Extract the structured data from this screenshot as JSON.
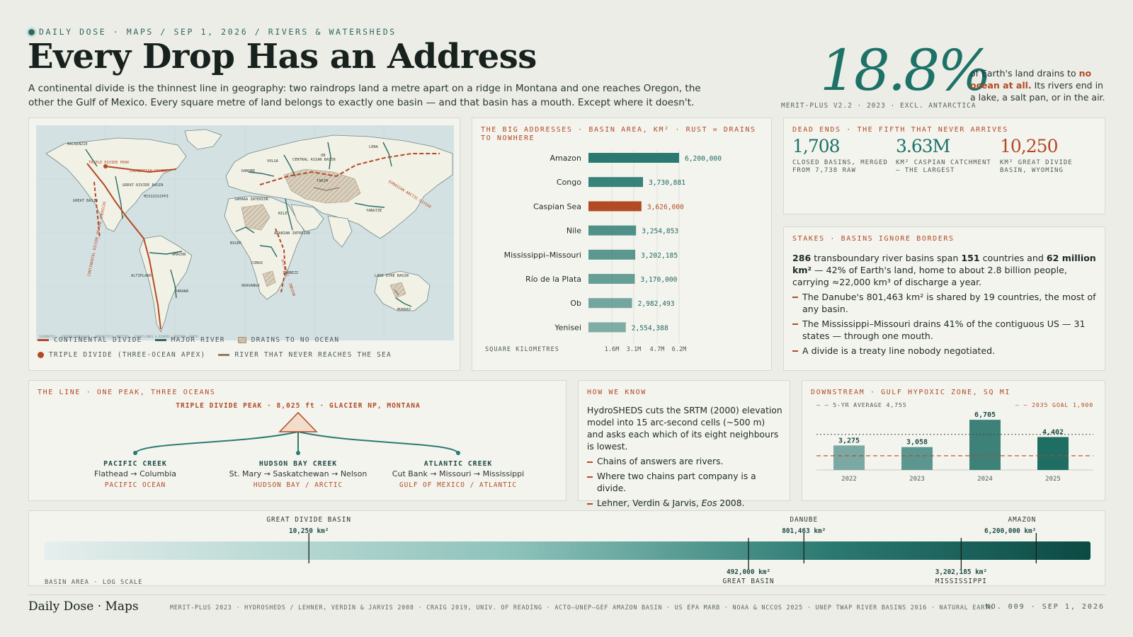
{
  "header": {
    "kicker": "DAILY DOSE · MAPS / SEP 1, 2026 / RIVERS & WATERSHEDS",
    "title": "Every Drop Has an Address",
    "lede": "A continental divide is the thinnest line in geography: two raindrops land a metre apart on a ridge in Montana and one reaches Oregon, the other the Gulf of Mexico. Every square metre of land belongs to exactly one basin — and that basin has a mouth. Except where it doesn't."
  },
  "hero": {
    "value": "18.8%",
    "note": "MERIT-PLUS V2.2 · 2023 · EXCL. ANTARCTICA",
    "text_pre": "of Earth's land drains to ",
    "text_highlight": "no ocean at all.",
    "text_post": " Its rivers end in a lake, a salt pan, or in the air."
  },
  "map": {
    "labels": {
      "mackenzie": "MACKENZIE",
      "triple_divide": "TRIPLE DIVIDE PEAK",
      "laurentian": "LAURENTIAN DIVIDE",
      "great_divide": "GREAT DIVIDE BASIN",
      "mississippi": "MISSISSIPPI",
      "great_basin": "GREAT BASIN",
      "continental": "CONTINENTAL DIVIDE OF THE AMERICAS",
      "amazon": "AMAZON",
      "altiplano": "ALTIPLANO",
      "parana": "PARANÁ",
      "volga": "VOLGA",
      "danube": "DANUBE",
      "central_asian": "CENTRAL ASIAN BASIN",
      "ob": "OB",
      "lena": "LENA",
      "eurasian": "EURASIAN ARCTIC DIVIDE",
      "tarim": "TARIM",
      "sahara": "SAHARA INTERIOR",
      "nile": "NILE",
      "yangtze": "YANGTZE",
      "arabian": "ARABIAN INTERIOR",
      "niger": "NIGER",
      "congo": "CONGO",
      "zambezi": "ZAMBEZI",
      "atlantic_indian": "ATLANTIC · INDIAN",
      "okavango": "OKAVANGO",
      "lake_eyre": "LAKE EYRE BASIN",
      "murray": "MURRAY",
      "credit": "SCHEMATIC · EQUIRECTANGULAR · ANTARCTICA OMITTED · COASTLINES & RIVERS: NATURAL EARTH"
    },
    "legend": {
      "continental": "CONTINENTAL DIVIDE",
      "river": "MAJOR RIVER",
      "no_ocean": "DRAINS TO NO OCEAN",
      "triple": "TRIPLE DIVIDE (THREE-OCEAN APEX)",
      "never_sea": "RIVER THAT NEVER REACHES THE SEA"
    }
  },
  "bars": {
    "caption": "THE BIG ADDRESSES · BASIN AREA, KM² · RUST = DRAINS TO NOWHERE",
    "axis_label": "SQUARE KILOMETRES"
  },
  "chart_data": [
    {
      "type": "bar",
      "orientation": "horizontal",
      "title": "THE BIG ADDRESSES · BASIN AREA, KM² · RUST = DRAINS TO NOWHERE",
      "xlabel": "SQUARE KILOMETRES",
      "categories": [
        "Amazon",
        "Congo",
        "Caspian Sea",
        "Nile",
        "Mississippi–Missouri",
        "Río de la Plata",
        "Ob",
        "Yenisei"
      ],
      "values": [
        6200000,
        3730881,
        3626000,
        3254853,
        3202185,
        3170000,
        2982493,
        2554388
      ],
      "value_labels": [
        "6,200,000",
        "3,730,881",
        "3,626,000",
        "3,254,853",
        "3,202,185",
        "3,170,000",
        "2,982,493",
        "2,554,388"
      ],
      "endorheic": [
        false,
        false,
        true,
        false,
        false,
        false,
        false,
        false
      ],
      "xticks": [
        1600000,
        3100000,
        4700000,
        6200000
      ],
      "xtick_labels": [
        "1.6M",
        "3.1M",
        "4.7M",
        "6.2M"
      ],
      "xlim": [
        0,
        6200000
      ],
      "grid": true,
      "colors": {
        "ocean": "#2b7a72",
        "nowhere": "#b24a26"
      }
    },
    {
      "type": "bar",
      "title": "DOWNSTREAM · GULF HYPOXIC ZONE, SQ MI",
      "categories": [
        "2022",
        "2023",
        "2024",
        "2025"
      ],
      "values": [
        3275,
        3058,
        6705,
        4402
      ],
      "value_labels": [
        "3,275",
        "3,058",
        "6,705",
        "4,402"
      ],
      "reference_lines": [
        {
          "label": "5-YR AVERAGE 4,755",
          "value": 4755,
          "style": "dotted"
        },
        {
          "label": "2035 GOAL 1,900",
          "value": 1900,
          "style": "dashed"
        }
      ],
      "ylim": [
        0,
        7000
      ],
      "colors": [
        "#7aa8a2",
        "#5c9690",
        "#3d8178",
        "#1f6e64"
      ]
    },
    {
      "type": "scale",
      "title": "BASIN AREA · LOG SCALE",
      "xlim": [
        1000,
        10000000
      ],
      "log": true,
      "points": [
        {
          "name": "GREAT DIVIDE BASIN",
          "value": 10250,
          "label": "10,250 km²",
          "position": "top"
        },
        {
          "name": "GREAT BASIN",
          "value": 492000,
          "label": "492,000 km²",
          "position": "bottom"
        },
        {
          "name": "DANUBE",
          "value": 801463,
          "label": "801,463 km²",
          "position": "top"
        },
        {
          "name": "MISSISSIPPI",
          "value": 3202185,
          "label": "3,202,185 km²",
          "position": "bottom"
        },
        {
          "name": "AMAZON",
          "value": 6200000,
          "label": "6,200,000 km²",
          "position": "top"
        }
      ]
    }
  ],
  "dead_ends": {
    "caption": "DEAD ENDS · THE FIFTH THAT NEVER ARRIVES",
    "stats": [
      {
        "value": "1,708",
        "label": "CLOSED BASINS, MERGED FROM 7,738 RAW",
        "color": "#1d7268"
      },
      {
        "value": "3.63M",
        "label": "KM² CASPIAN CATCHMENT — THE LARGEST",
        "color": "#1d7268"
      },
      {
        "value": "10,250",
        "label": "KM² GREAT DIVIDE BASIN, WYOMING",
        "color": "#b24a26"
      }
    ]
  },
  "stakes": {
    "caption": "STAKES · BASINS IGNORE BORDERS",
    "n1": "286",
    "t1": " transboundary river basins span ",
    "n2": "151",
    "t2": " countries and ",
    "n3": "62 million km²",
    "t3": " — 42% of Earth's land, home to about 2.8 billion people, carrying ≈22,000 km³ of discharge a year.",
    "bullets": [
      "The Danube's 801,463 km² is shared by 19 countries, the most of any basin.",
      "The Mississippi–Missouri drains 41% of the contiguous US — 31 states — through one mouth.",
      "A divide is a treaty line nobody negotiated."
    ]
  },
  "the_line": {
    "caption": "THE LINE · ONE PEAK, THREE OCEANS",
    "peak": "TRIPLE DIVIDE PEAK · 8,025 ft · GLACIER NP, MONTANA",
    "branches": [
      {
        "name": "PACIFIC CREEK",
        "path": "Flathead → Columbia",
        "ocean": "PACIFIC OCEAN"
      },
      {
        "name": "HUDSON BAY CREEK",
        "path": "St. Mary → Saskatchewan → Nelson",
        "ocean": "HUDSON BAY / ARCTIC"
      },
      {
        "name": "ATLANTIC CREEK",
        "path": "Cut Bank → Missouri → Mississippi",
        "ocean": "GULF OF MEXICO / ATLANTIC"
      }
    ]
  },
  "how": {
    "caption": "HOW WE KNOW",
    "body": "HydroSHEDS cuts the SRTM (2000) elevation model into 15 arc-second cells (~500 m) and asks each which of its eight neighbours is lowest.",
    "bullets": [
      "Chains of answers are rivers.",
      "Where two chains part company is a divide."
    ],
    "cite_pre": "Lehner, Verdin & Jarvis, ",
    "cite_em": "Eos",
    "cite_post": " 2008."
  },
  "downstream": {
    "caption": "DOWNSTREAM · GULF HYPOXIC ZONE, SQ MI",
    "avg_label": "— — 5-YR AVERAGE 4,755",
    "goal_label": "— — 2035 GOAL 1,900"
  },
  "scale": {
    "axis_label": "BASIN AREA · LOG SCALE"
  },
  "footer": {
    "brand": "Daily Dose · Maps",
    "sources": "MERIT-PLUS 2023 · HYDROSHEDS / LEHNER, VERDIN & JARVIS 2008 · CRAIG 2019, UNIV. OF READING · ACTO–UNEP–GEF AMAZON BASIN · US EPA MARB · NOAA & NCCOS 2025 · UNEP TWAP RIVER BASINS 2016 · NATURAL EARTH",
    "issue": "NO. 009 · SEP 1, 2026"
  },
  "colors": {
    "teal": "#1d7268",
    "rust": "#b24a26",
    "paper": "#ecede6",
    "card": "#f4f4ee",
    "land": "#f2f1e6",
    "sea": "#d4e1e3"
  }
}
